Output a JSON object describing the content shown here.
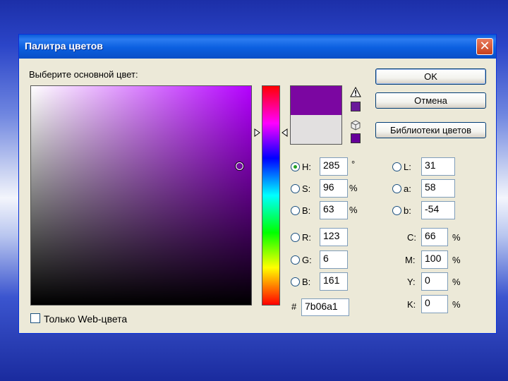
{
  "window": {
    "title": "Палитра цветов",
    "close_glyph": "✕"
  },
  "prompt": "Выберите основной цвет:",
  "buttons": {
    "ok": "OK",
    "cancel": "Отмена",
    "libraries": "Библиотеки цветов"
  },
  "colors": {
    "new": "#7b06a1",
    "current": "#e2e0e0",
    "web_safe": "#660099"
  },
  "hsb": {
    "h": {
      "label": "H:",
      "value": "285",
      "unit": "°",
      "checked": true
    },
    "s": {
      "label": "S:",
      "value": "96",
      "unit": "%"
    },
    "b": {
      "label": "B:",
      "value": "63",
      "unit": "%"
    }
  },
  "rgb": {
    "r": {
      "label": "R:",
      "value": "123"
    },
    "g": {
      "label": "G:",
      "value": "6"
    },
    "b": {
      "label": "B:",
      "value": "161"
    }
  },
  "lab": {
    "l": {
      "label": "L:",
      "value": "31"
    },
    "a": {
      "label": "a:",
      "value": "58"
    },
    "b": {
      "label": "b:",
      "value": "-54"
    }
  },
  "cmyk": {
    "c": {
      "label": "C:",
      "value": "66",
      "unit": "%"
    },
    "m": {
      "label": "M:",
      "value": "100",
      "unit": "%"
    },
    "y": {
      "label": "Y:",
      "value": "0",
      "unit": "%"
    },
    "k": {
      "label": "K:",
      "value": "0",
      "unit": "%"
    }
  },
  "hex": {
    "prefix": "#",
    "value": "7b06a1"
  },
  "web_only": {
    "label": "Только Web-цвета",
    "checked": false
  },
  "icons": [
    "warning-icon",
    "cube-icon",
    "close-icon"
  ]
}
